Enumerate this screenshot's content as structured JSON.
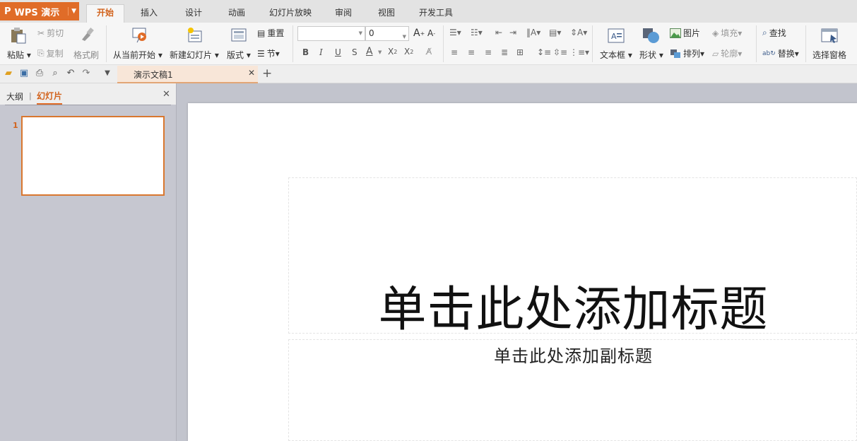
{
  "app": {
    "name": "WPS 演示"
  },
  "menu_tabs": [
    "开始",
    "插入",
    "设计",
    "动画",
    "幻灯片放映",
    "审阅",
    "视图",
    "开发工具"
  ],
  "ribbon": {
    "paste": "粘贴",
    "cut": "剪切",
    "copy": "复制",
    "format_painter": "格式刷",
    "from_current": "从当前开始",
    "new_slide": "新建幻灯片",
    "layout": "版式",
    "reset": "重置",
    "section": "节",
    "font_name": "",
    "font_size": "0",
    "text_box": "文本框",
    "shape": "形状",
    "picture": "图片",
    "arrange": "排列",
    "fill": "填充",
    "outline": "轮廓",
    "find": "查找",
    "replace": "替换",
    "selection_pane": "选择窗格"
  },
  "document_tab": {
    "title": "演示文稿1"
  },
  "left_panel": {
    "outline_tab": "大纲",
    "slides_tab": "幻灯片",
    "slides": [
      {
        "number": "1"
      }
    ]
  },
  "slide": {
    "title_placeholder": "单击此处添加标题",
    "subtitle_placeholder": "单击此处添加副标题"
  },
  "colors": {
    "accent": "#e06c28",
    "active_tab_text": "#d2631d",
    "panel_bg": "#c6c7d0"
  }
}
